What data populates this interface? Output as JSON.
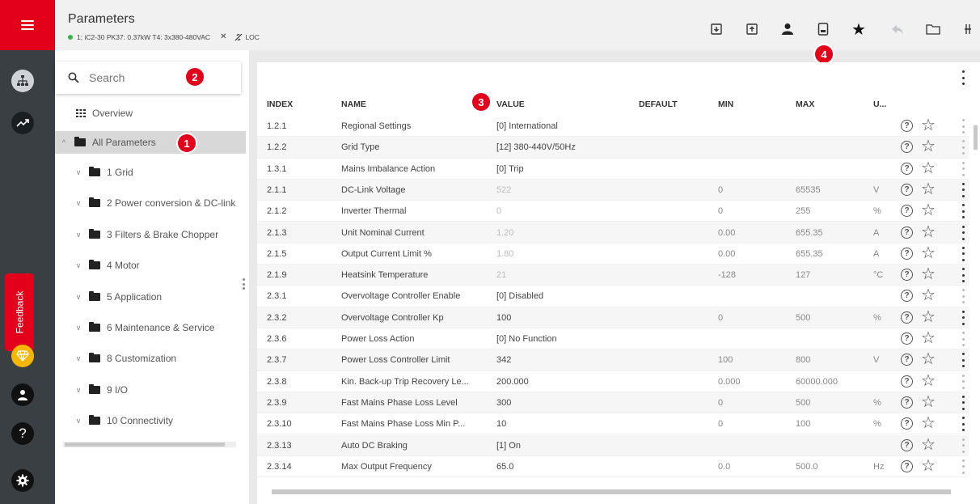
{
  "header": {
    "title": "Parameters",
    "subtitle": "1; iC2-30 PK37: 0.37kW T4: 3x380-480VAC",
    "close_glyph": "✕",
    "mode": "LOC",
    "status_color": "#36b34a",
    "toolbar_icons": [
      "download-icon",
      "upload-icon",
      "user-icon",
      "save-icon",
      "star-icon",
      "undo-icon",
      "folder-icon",
      "overflow-icon"
    ]
  },
  "rail": {
    "accent": "#e2001a",
    "feedback_label": "Feedback",
    "icons": [
      "menu-icon",
      "network-icon",
      "trend-icon",
      "premium-icon",
      "user-icon",
      "help-icon",
      "settings-icon"
    ]
  },
  "search": {
    "placeholder": "Search"
  },
  "tree": {
    "overview": "Overview",
    "all_parameters": "All Parameters",
    "groups": [
      "1 Grid",
      "2 Power conversion & DC-link",
      "3 Filters & Brake Chopper",
      "4 Motor",
      "5 Application",
      "6 Maintenance & Service",
      "8 Customization",
      "9 I/O",
      "10 Connectivity"
    ]
  },
  "badges": [
    "1",
    "2",
    "3",
    "4"
  ],
  "table": {
    "columns": [
      "INDEX",
      "NAME",
      "VALUE",
      "DEFAULT",
      "MIN",
      "MAX",
      "U..."
    ],
    "rows": [
      {
        "index": "1.2.1",
        "name": "Regional Settings",
        "value": "[0] International",
        "default": "",
        "min": "",
        "max": "",
        "unit": ""
      },
      {
        "index": "1.2.2",
        "name": "Grid Type",
        "value": "[12] 380-440V/50Hz",
        "default": "",
        "min": "",
        "max": "",
        "unit": ""
      },
      {
        "index": "1.3.1",
        "name": "Mains Imbalance Action",
        "value": "[0] Trip",
        "default": "",
        "min": "",
        "max": "",
        "unit": ""
      },
      {
        "index": "2.1.1",
        "name": "DC-Link Voltage",
        "value": "522",
        "default": "",
        "min": "0",
        "max": "65535",
        "unit": "V"
      },
      {
        "index": "2.1.2",
        "name": "Inverter Thermal",
        "value": "0",
        "default": "",
        "min": "0",
        "max": "255",
        "unit": "%"
      },
      {
        "index": "2.1.3",
        "name": "Unit Nominal Current",
        "value": "1.20",
        "default": "",
        "min": "0.00",
        "max": "655.35",
        "unit": "A"
      },
      {
        "index": "2.1.5",
        "name": "Output Current Limit %",
        "value": "1.80",
        "default": "",
        "min": "0.00",
        "max": "655.35",
        "unit": "A"
      },
      {
        "index": "2.1.9",
        "name": "Heatsink Temperature",
        "value": "21",
        "default": "",
        "min": "-128",
        "max": "127",
        "unit": "°C"
      },
      {
        "index": "2.3.1",
        "name": "Overvoltage Controller Enable",
        "value": "[0] Disabled",
        "default": "",
        "min": "",
        "max": "",
        "unit": ""
      },
      {
        "index": "2.3.2",
        "name": "Overvoltage Controller Kp",
        "value": "100",
        "default": "",
        "min": "0",
        "max": "500",
        "unit": "%"
      },
      {
        "index": "2.3.6",
        "name": "Power Loss Action",
        "value": "[0] No Function",
        "default": "",
        "min": "",
        "max": "",
        "unit": ""
      },
      {
        "index": "2.3.7",
        "name": "Power Loss Controller Limit",
        "value": "342",
        "default": "",
        "min": "100",
        "max": "800",
        "unit": "V"
      },
      {
        "index": "2.3.8",
        "name": "Kin. Back-up Trip Recovery Le...",
        "value": "200.000",
        "default": "",
        "min": "0.000",
        "max": "60000.000",
        "unit": ""
      },
      {
        "index": "2.3.9",
        "name": "Fast Mains Phase Loss Level",
        "value": "300",
        "default": "",
        "min": "0",
        "max": "500",
        "unit": "%"
      },
      {
        "index": "2.3.10",
        "name": "Fast Mains Phase Loss Min P...",
        "value": "10",
        "default": "",
        "min": "0",
        "max": "100",
        "unit": "%"
      },
      {
        "index": "2.3.13",
        "name": "Auto DC Braking",
        "value": "[1] On",
        "default": "",
        "min": "",
        "max": "",
        "unit": ""
      },
      {
        "index": "2.3.14",
        "name": "Max Output Frequency",
        "value": "65.0",
        "default": "",
        "min": "0.0",
        "max": "500.0",
        "unit": "Hz"
      }
    ]
  }
}
